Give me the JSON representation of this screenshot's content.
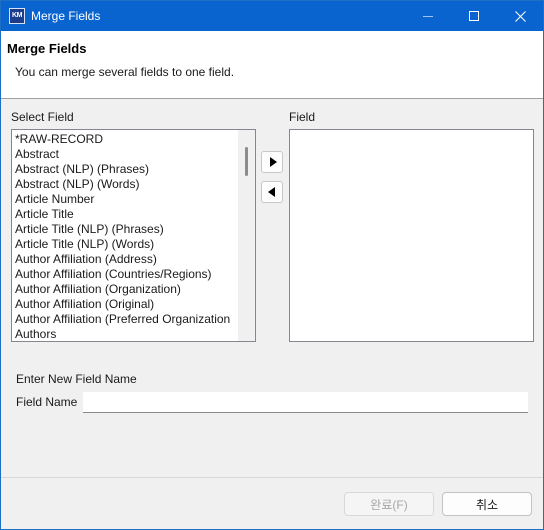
{
  "window": {
    "title": "Merge Fields",
    "icon_label": "KM",
    "controls": [
      "minimize-icon",
      "maximize-icon",
      "close-icon"
    ]
  },
  "header": {
    "title": "Merge Fields",
    "description": "You can merge several fields to one field."
  },
  "select_field": {
    "label": "Select Field",
    "items": [
      "*RAW-RECORD",
      "Abstract",
      "Abstract (NLP) (Phrases)",
      "Abstract (NLP) (Words)",
      "Article Number",
      "Article Title",
      "Article Title (NLP) (Phrases)",
      "Article Title (NLP) (Words)",
      "Author Affiliation (Address)",
      "Author Affiliation (Countries/Regions)",
      "Author Affiliation (Organization)",
      "Author Affiliation (Original)",
      "Author Affiliation (Preferred Organization",
      "Authors"
    ]
  },
  "field": {
    "label": "Field",
    "items": []
  },
  "buttons": {
    "add_icon": "triangle-right-icon",
    "remove_icon": "triangle-left-icon"
  },
  "new_field": {
    "section_label": "Enter New Field Name",
    "name_label": "Field Name",
    "value": "",
    "placeholder": ""
  },
  "footer": {
    "finish_label": "완료(F)",
    "cancel_label": "취소"
  },
  "colors": {
    "titlebar": "#0a64cf",
    "dialog_bg": "#f0f0f0",
    "list_border": "#828790"
  }
}
